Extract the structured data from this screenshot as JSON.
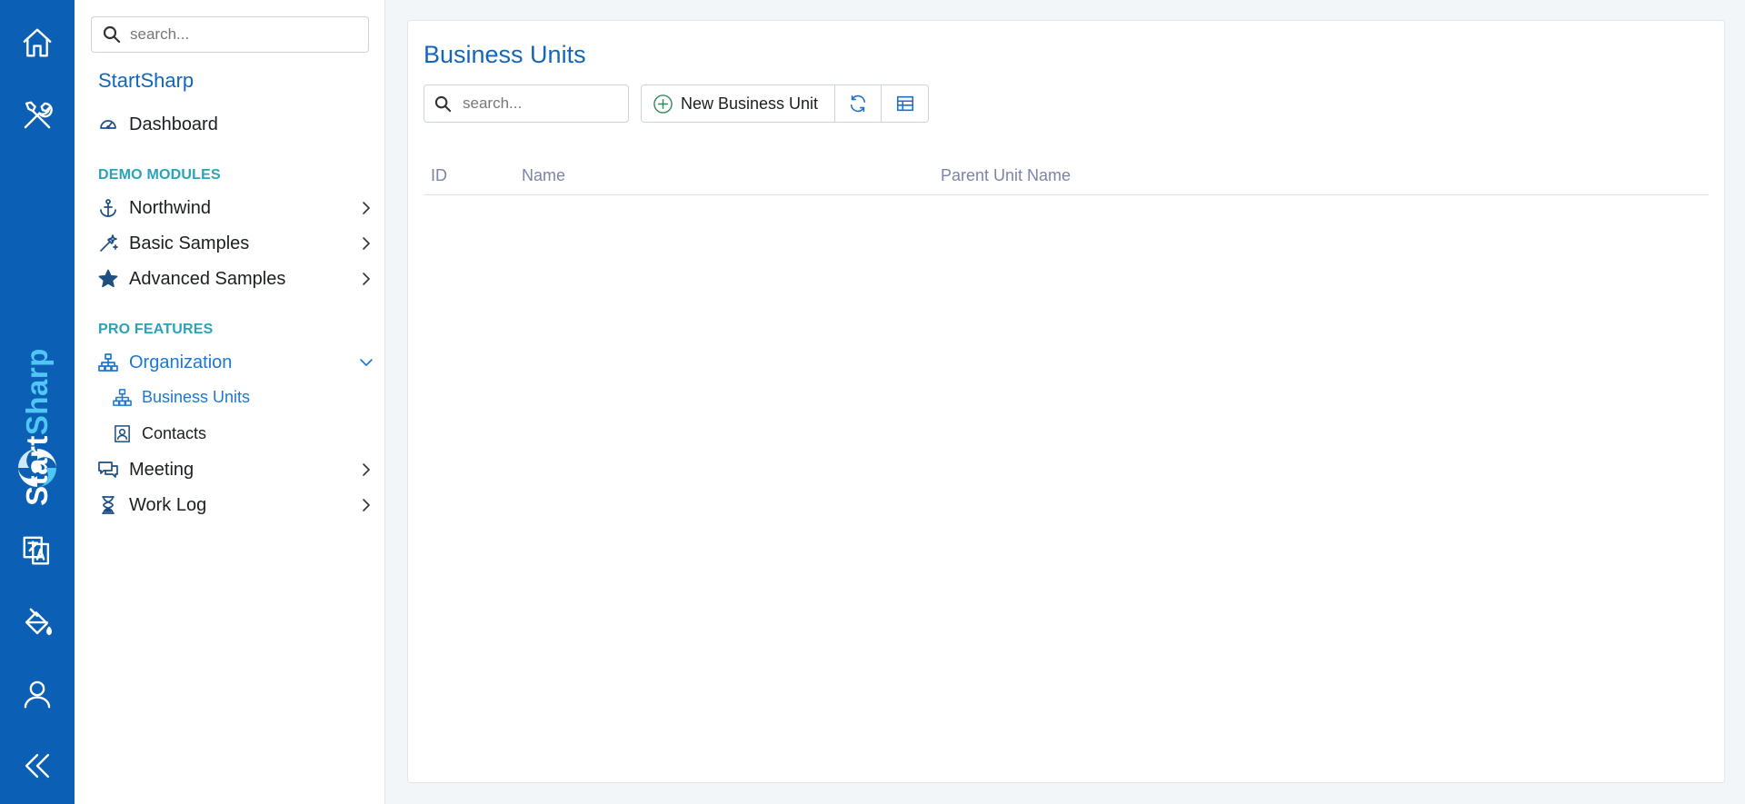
{
  "rail": {
    "brand_part1": "Start",
    "brand_part2": "Sharp",
    "icons": [
      "home-icon",
      "tools-icon",
      "translate-icon",
      "paint-bucket-icon",
      "user-icon",
      "collapse-icon"
    ]
  },
  "sidebar": {
    "search_placeholder": "search...",
    "title": "StartSharp",
    "dashboard": "Dashboard",
    "section_demo": "DEMO MODULES",
    "demo_items": [
      "Northwind",
      "Basic Samples",
      "Advanced Samples"
    ],
    "section_pro": "PRO FEATURES",
    "organization": "Organization",
    "org_children": [
      "Business Units",
      "Contacts"
    ],
    "pro_items": [
      "Meeting",
      "Work Log"
    ]
  },
  "main": {
    "title": "Business Units",
    "search_placeholder": "search...",
    "new_button": "New Business Unit",
    "columns": [
      "ID",
      "Name",
      "Parent Unit Name"
    ],
    "rows": []
  },
  "colors": {
    "rail_bg": "#0b5fb4",
    "accent": "#1466b8",
    "active": "#1a78d4",
    "section": "#2aa3b9",
    "header_text": "#7b85a6"
  }
}
